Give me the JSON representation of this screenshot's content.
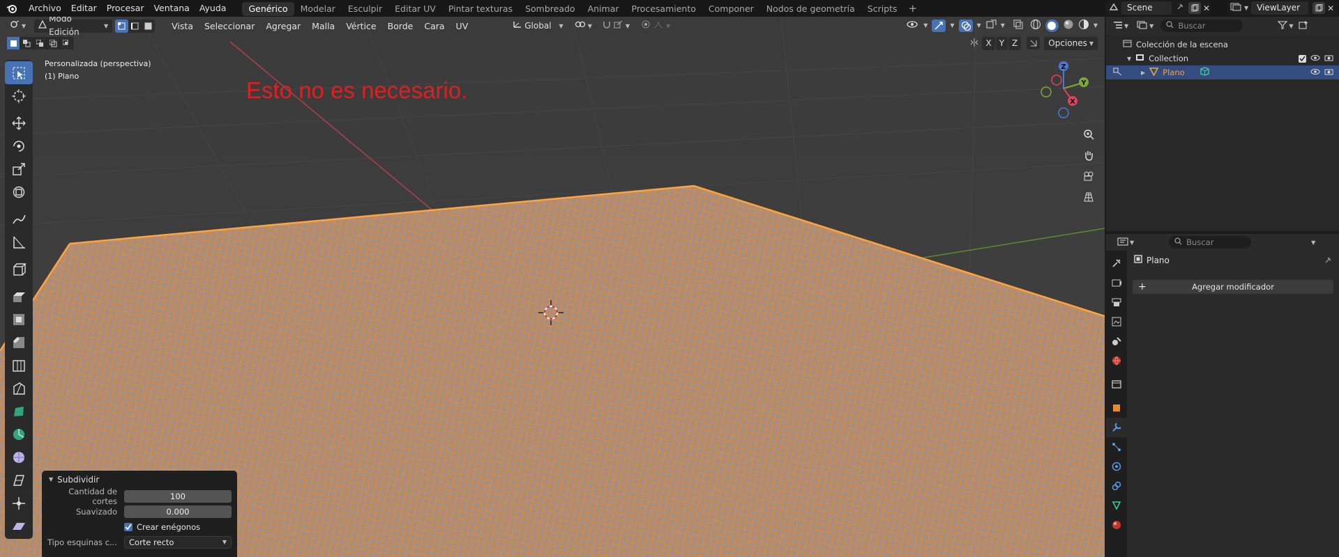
{
  "menu": [
    "Archivo",
    "Editar",
    "Procesar",
    "Ventana",
    "Ayuda"
  ],
  "workspaces": [
    "Genérico",
    "Modelar",
    "Esculpir",
    "Editar UV",
    "Pintar texturas",
    "Sombreado",
    "Animar",
    "Procesamiento",
    "Componer",
    "Nodos de geometría",
    "Scripts"
  ],
  "active_workspace": "Genérico",
  "scene": {
    "name": "Scene",
    "view_layer": "ViewLayer"
  },
  "viewport": {
    "mode": "Modo Edición",
    "menus": [
      "Vista",
      "Seleccionar",
      "Agregar",
      "Malla",
      "Vértice",
      "Borde",
      "Cara",
      "UV"
    ],
    "transform_orientation": "Global",
    "axis_labels": [
      "X",
      "Y",
      "Z"
    ],
    "options_label": "Opciones",
    "view_name": "Personalizada (perspectiva)",
    "object_info": "(1) Plano",
    "annotation": "Esto no es necesario.",
    "gizmo_axes": {
      "x": "X",
      "y": "Y",
      "z": "Z"
    },
    "accent_color": "#4772b3",
    "mesh_color": "#f08a24"
  },
  "operator_panel": {
    "title": "Subdividir",
    "cuts_label": "Cantidad de cortes",
    "cuts_value": "100",
    "smooth_label": "Suavizado",
    "smooth_value": "0.000",
    "ngons_label": "Crear enégonos",
    "ngons_checked": true,
    "corner_label": "Tipo esquinas c...",
    "corner_value": "Corte recto"
  },
  "outliner": {
    "search_placeholder": "Buscar",
    "root": "Colección de la escena",
    "collection": "Collection",
    "object": "Plano"
  },
  "properties": {
    "search_placeholder": "Buscar",
    "object_name": "Plano",
    "add_modifier": "Agregar modificador"
  }
}
